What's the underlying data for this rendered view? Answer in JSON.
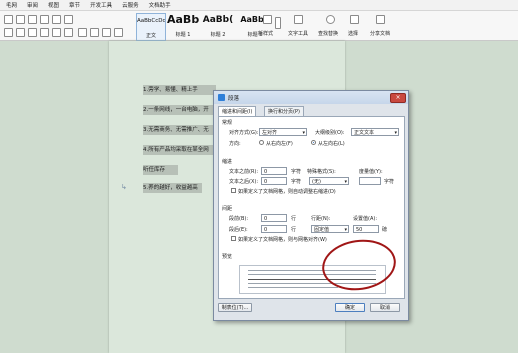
{
  "menu": [
    "毛网",
    "审阅",
    "视图",
    "章节",
    "开发工具",
    "云服务",
    "文档助手"
  ],
  "ribbon": {
    "styles": [
      {
        "preview": "AaBbCcDd",
        "caption": "正文"
      },
      {
        "preview": "AaBb",
        "caption": "标题 1"
      },
      {
        "preview": "AaBb(",
        "caption": "标题 2"
      },
      {
        "preview": "AaBbC",
        "caption": "标题 3"
      }
    ],
    "new_style": "新样式",
    "text_tool": "文字工具",
    "find_replace": "查找替换",
    "select": "选择",
    "share": "分享文档"
  },
  "document": {
    "paragraphs": [
      "1.旁学、易懂、精上手",
      "2.一条网线，一台电脑，开",
      "3.无需商务、无需推广、无",
      "4.所有产品均采取在某全网",
      "听任库存",
      "5.养的越好，收益越高"
    ]
  },
  "dialog": {
    "title": "段落",
    "close": "×",
    "tabs": [
      "缩进和间距(I)",
      "换行和分页(P)"
    ],
    "general": {
      "section": "常规",
      "align_label": "对齐方式(G):",
      "align_value": "左对齐",
      "outline_label": "大纲级别(O):",
      "outline_value": "正文文本",
      "direction_label": "方向:",
      "rtl": "从右向左(F)",
      "ltr": "从左向右(L)"
    },
    "indent": {
      "section": "缩进",
      "before_label": "文本之前(R):",
      "before_value": "0",
      "before_unit": "字符",
      "special_label": "特殊格式(S):",
      "special_value": "(无)",
      "by_label": "度量值(Y):",
      "by_unit": "字符",
      "after_label": "文本之后(X):",
      "after_value": "0",
      "after_unit": "字符",
      "grid_check": "如果定义了文档网格，则自动调整右缩进(D)"
    },
    "spacing": {
      "section": "间距",
      "before_label": "段前(B):",
      "before_value": "0",
      "before_unit": "行",
      "line_label": "行距(N):",
      "setting_label": "设置值(A):",
      "after_label": "段后(E):",
      "after_value": "0",
      "after_unit": "行",
      "line_value": "固定值",
      "setting_value": "50",
      "setting_unit": "磅",
      "grid_check": "如果定义了文档网格，则与网格对齐(W)"
    },
    "preview_label": "预览",
    "tabs_button": "制表位(T)...",
    "ok": "确定",
    "cancel": "取消"
  },
  "colors": {
    "annotation_circle": "#a01616",
    "page": "#dbe7db",
    "highlight": "#b7c0b7"
  }
}
